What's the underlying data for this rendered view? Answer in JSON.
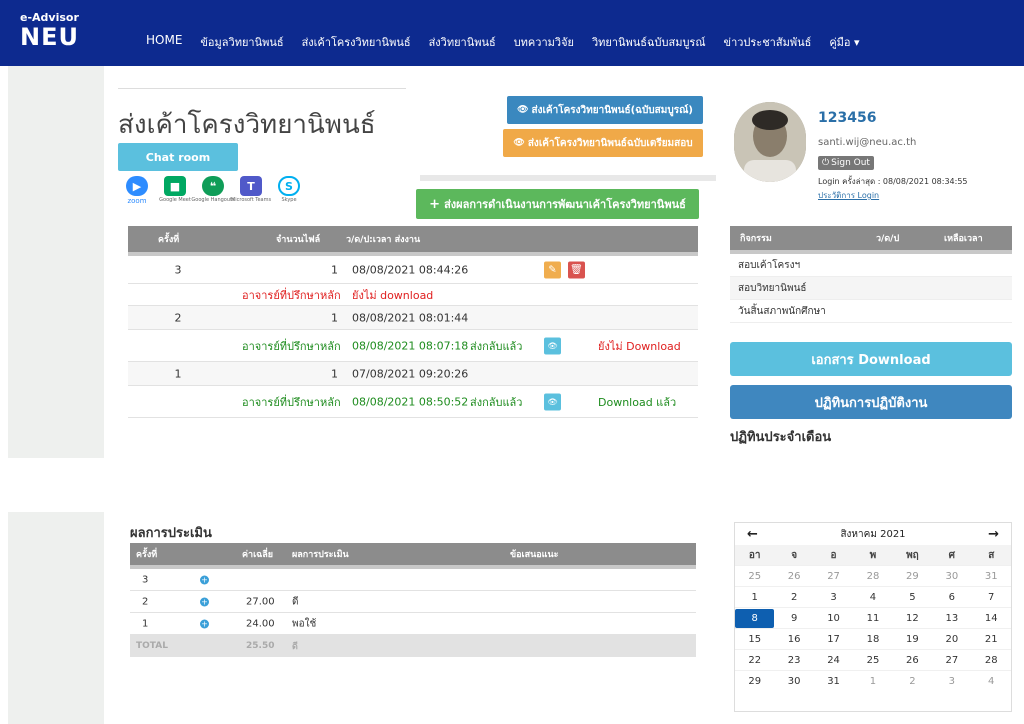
{
  "brand": {
    "line1": "e-Advisor",
    "line2": "NEU"
  },
  "nav": {
    "items": [
      "HOME",
      "ข้อมูลวิทยานิพนธ์",
      "ส่งเค้าโครงวิทยานิพนธ์",
      "ส่งวิทยานิพนธ์",
      "บทความวิจัย",
      "วิทยานิพนธ์ฉบับสมบูรณ์",
      "ข่าวประชาสัมพันธ์"
    ],
    "manual": "คู่มือ",
    "caret": "▾"
  },
  "page": {
    "title": "ส่งเค้าโครงวิทยานิพนธ์",
    "chatroom_label": "Chat room",
    "btn_full": "ส่งเค้าโครงวิทยานิพนธ์(ฉบับสมบูรณ์)",
    "btn_exam": "ส่งเค้าโครงวิทยานิพนธ์ฉบับเตรียมสอบ",
    "btn_progress": "ส่งผลการดำเนินงานการพัฒนาเค้าโครงวิทยานิพนธ์",
    "eye_glyph": "👁",
    "plus_glyph": "+"
  },
  "apps": [
    {
      "name": "zoom",
      "glyph": "▶",
      "caption": "zoom",
      "color": "#2d8cff"
    },
    {
      "name": "google-meet",
      "glyph": "■",
      "caption": "Google Meet",
      "color": "#00a862"
    },
    {
      "name": "hangouts",
      "glyph": "❝",
      "caption": "Google Hangouts",
      "color": "#0f9d58"
    },
    {
      "name": "teams",
      "glyph": "T",
      "caption": "Microsoft Teams",
      "color": "#5059c9"
    },
    {
      "name": "skype",
      "glyph": "S",
      "caption": "Skype",
      "color": "#00aff0"
    }
  ],
  "submissions": {
    "headers": {
      "round": "ครั้งที่",
      "files": "จำนวนไฟล์",
      "datetime": "ว/ด/ป:เวลา ส่งงาน"
    },
    "rows": [
      {
        "round": "3",
        "files": "1",
        "datetime": "08/08/2021 08:44:26",
        "advisor": "อาจารย์ที่ปรึกษาหลัก",
        "feedback_date": "ยังไม่ download",
        "status": "",
        "download": ""
      },
      {
        "round": "2",
        "files": "1",
        "datetime": "08/08/2021 08:01:44",
        "advisor": "อาจารย์ที่ปรึกษาหลัก",
        "feedback_date": "08/08/2021 08:07:18",
        "status": "ส่งกลับแล้ว",
        "download": "ยังไม่ Download"
      },
      {
        "round": "1",
        "files": "1",
        "datetime": "07/08/2021 09:20:26",
        "advisor": "อาจารย์ที่ปรึกษาหลัก",
        "feedback_date": "08/08/2021 08:50:52",
        "status": "ส่งกลับแล้ว",
        "download": "Download แล้ว"
      }
    ]
  },
  "profile": {
    "username": "123456",
    "email": "santi.wij@neu.ac.th",
    "signout": "Sign Out",
    "last_login": "Login ครั้งล่าสุด : 08/08/2021 08:34:55",
    "login_history": "ประวัติการ Login"
  },
  "activity": {
    "headers": {
      "activity": "กิจกรรม",
      "date": "ว/ด/ป",
      "remaining": "เหลือเวลา"
    },
    "items": [
      "สอบเค้าโครงฯ",
      "สอบวิทยานิพนธ์",
      "วันสิ้นสภาพนักศึกษา"
    ]
  },
  "sidebar_buttons": {
    "documents": "เอกสาร Download",
    "work_calendar": "ปฏิทินการปฏิบัติงาน",
    "monthly_calendar": "ปฏิทินประจำเดือน"
  },
  "evaluation": {
    "title": "ผลการประเมิน",
    "headers": {
      "round": "ครั้งที่",
      "average": "ค่าเฉลี่ย",
      "result": "ผลการประเมิน",
      "suggestion": "ข้อเสนอแนะ"
    },
    "rows": [
      {
        "round": "3",
        "average": "",
        "result": ""
      },
      {
        "round": "2",
        "average": "27.00",
        "result": "ดี"
      },
      {
        "round": "1",
        "average": "24.00",
        "result": "พอใช้"
      }
    ],
    "total": {
      "label": "TOTAL",
      "average": "25.50",
      "result": "ดี"
    }
  },
  "calendar": {
    "month_label": "สิงหาคม 2021",
    "prev": "←",
    "next": "→",
    "weekdays": [
      "อา",
      "จ",
      "อ",
      "พ",
      "พฤ",
      "ศ",
      "ส"
    ],
    "weeks": [
      [
        "25",
        "26",
        "27",
        "28",
        "29",
        "30",
        "31"
      ],
      [
        "1",
        "2",
        "3",
        "4",
        "5",
        "6",
        "7"
      ],
      [
        "8",
        "9",
        "10",
        "11",
        "12",
        "13",
        "14"
      ],
      [
        "15",
        "16",
        "17",
        "18",
        "19",
        "20",
        "21"
      ],
      [
        "22",
        "23",
        "24",
        "25",
        "26",
        "27",
        "28"
      ],
      [
        "29",
        "30",
        "31",
        "1",
        "2",
        "3",
        "4"
      ]
    ],
    "today": "8"
  }
}
